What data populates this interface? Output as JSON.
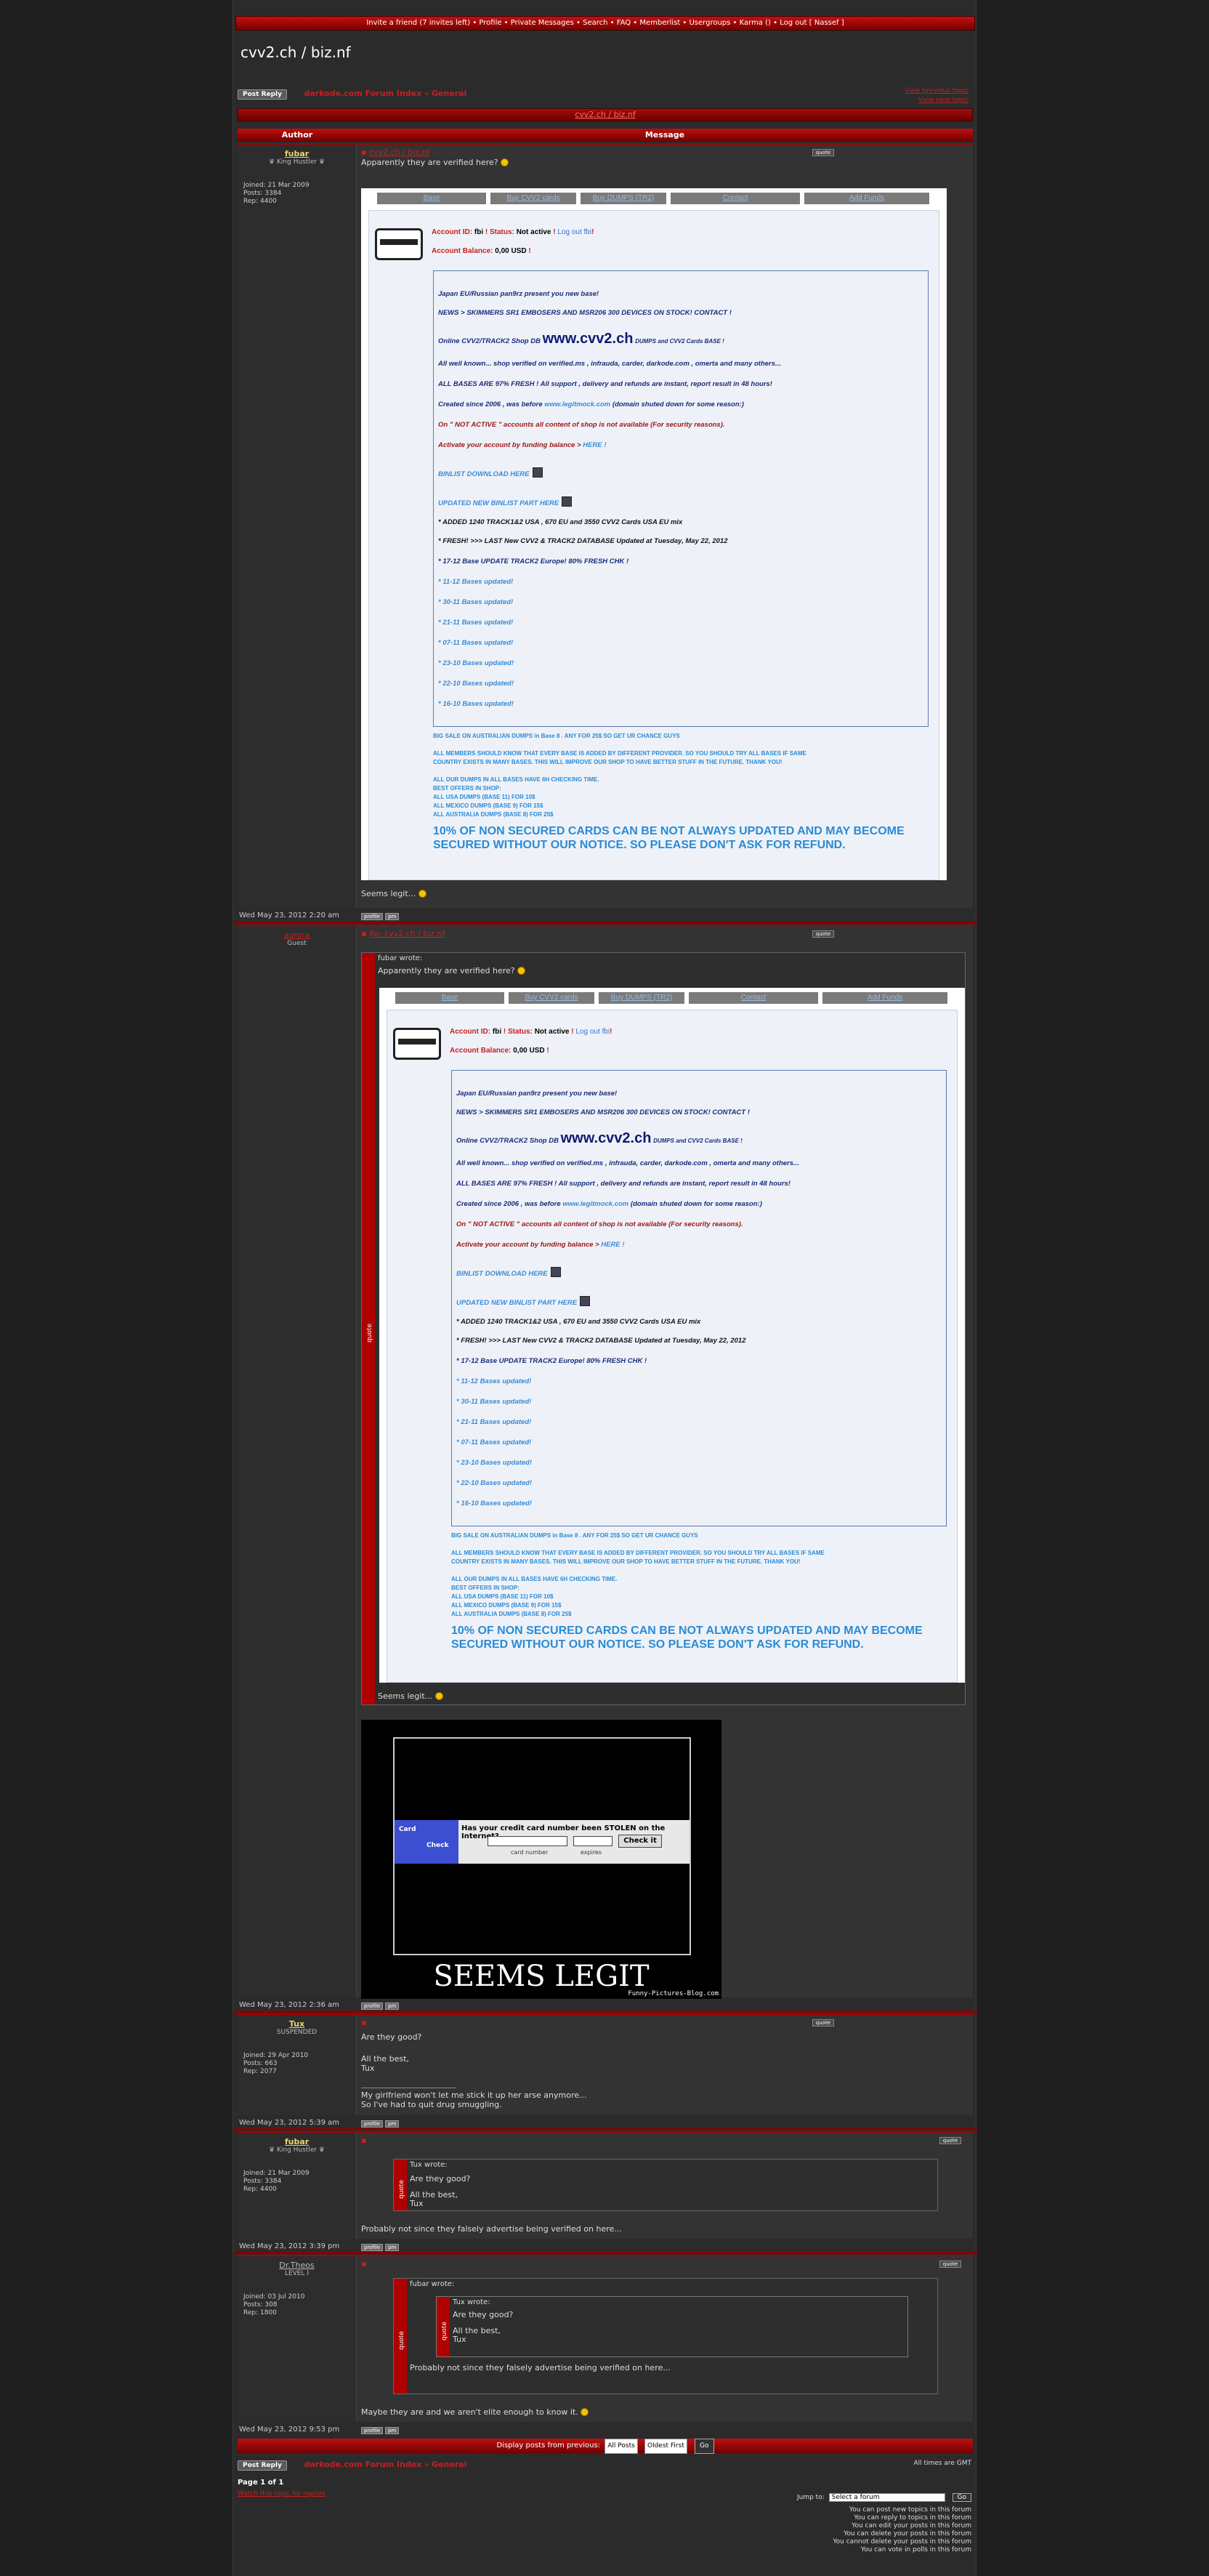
{
  "nav": {
    "links": [
      "Invite a friend (7 invites left)",
      "Profile",
      "Private Messages",
      "Search",
      "FAQ",
      "Memberlist",
      "Usergroups",
      "Karma ()",
      "Log out [ Nassef ]"
    ],
    "separator": " • "
  },
  "site_title": "cvv2.ch / biz.nf",
  "toolbar": {
    "post_reply": "Post Reply",
    "forum_index": "darkode.com Forum Index",
    "breadcrumb_sep": "»",
    "forum": "General",
    "prev_topic": "View previous topic",
    "next_topic": "View next topic"
  },
  "topic": {
    "title": "cvv2.ch / biz.nf",
    "col_author": "Author",
    "col_message": "Message"
  },
  "quote_label": "quote",
  "footer_buttons": [
    "profile",
    "pm"
  ],
  "shop": {
    "tabs": [
      "Base",
      "Buy CVV2 cards",
      "Buy DUMPS (TR2)",
      "Contact",
      "Add Funds"
    ],
    "account_id_label": "Account ID:",
    "account_id": "fbi",
    "status_label": "Status:",
    "status": "Not active",
    "logout": "Log out fbi",
    "balance_label": "Account Balance:",
    "balance": "0,00 USD",
    "lines": [
      "Japan EU/Russian pan9rz present you new base!",
      "NEWS > SKIMMERS SR1 EMBOSERS AND MSR206 300 DEVICES ON STOCK! CONTACT !",
      "Online CVV2/TRACK2 Shop DB",
      "www.cvv2.ch",
      "DUMPS and CVV2 Cards BASE !",
      "All well known... shop verified on verified.ms , infrauda, carder, darkode.com , omerta and many others...",
      "ALL BASES ARE 97% FRESH ! All support , delivery and refunds are instant, report result in 48 hours!",
      "Created since 2006 , was before",
      "www.legitmock.com",
      "(domain shuted down for some reason:)",
      "On \" NOT ACTIVE \" accounts all content of shop is not available (For security reasons).",
      "Activate your account by funding balance >",
      "HERE !",
      "BINLIST DOWNLOAD HERE",
      "UPDATED NEW BINLIST PART HERE",
      "* ADDED 1240 TRACK1&2 USA , 670 EU and 3550 CVV2 Cards USA EU mix",
      "* FRESH! >>> LAST New CVV2 & TRACK2 DATABASE Updated at Tuesday, May 22, 2012",
      "* 17-12 Base UPDATE TRACK2 Europe! 80% FRESH CHK !",
      "* 11-12 Bases updated!",
      "* 30-11 Bases updated!",
      "* 21-11 Bases updated!",
      "* 07-11 Bases updated!",
      "* 23-10 Bases updated!",
      "* 22-10 Bases updated!",
      "* 16-10 Bases updated!"
    ],
    "extra": [
      "BIG SALE ON AUSTRALIAN DUMPS in Base 8 . ANY FOR 25$ SO GET UR CHANCE GUYS",
      "ALL MEMBERS SHOULD KNOW THAT EVERY BASE IS ADDED BY DIFFERENT PROVIDER. SO YOU SHOULD TRY ALL BASES IF SAME",
      "COUNTRY EXISTS IN MANY BASES. THIS WILL IMPROVE OUR SHOP TO HAVE BETTER STUFF IN THE FUTURE. THANK YOU!",
      "ALL OUR DUMPS IN ALL BASES HAVE 6H CHECKING TIME.",
      "BEST OFFERS IN SHOP:",
      "ALL USA DUMPS (BASE 11) FOR 10$",
      "ALL MEXICO DUMPS (BASE 9) FOR 15$",
      "ALL AUSTRALIA DUMPS (BASE 8) FOR 25$"
    ],
    "warning": "10% OF NON SECURED CARDS CAN BE NOT ALWAYS UPDATED AND MAY BECOME SECURED WITHOUT OUR NOTICE. SO PLEASE DON'T ASK FOR REFUND."
  },
  "posts": [
    {
      "author": "fubar",
      "rank": "♛ King Hustler ♛",
      "joined": "Joined: 21 Mar 2009",
      "posts": "Posts: 3384",
      "rep": "Rep: 4400",
      "subject": "cvv2.ch / biz.nf",
      "text": "Apparently they are verified here?",
      "after": "Seems legit...",
      "date": "Wed May 23, 2012 2:20 am"
    },
    {
      "author": "aurora",
      "rank": "Guest",
      "subject": "Re: cvv2.ch / biz.nf",
      "quote_header": "fubar wrote:",
      "quote_text": "Apparently they are verified here?",
      "quote_after": "Seems legit...",
      "date": "Wed May 23, 2012 2:36 am"
    },
    {
      "author": "Tux",
      "rank": "SUSPENDED",
      "joined": "Joined: 29 Apr 2010",
      "posts": "Posts: 663",
      "rep": "Rep: 2077",
      "text1": "Are they good?",
      "text2": "All the best,",
      "text3": "Tux",
      "sig1": "My girlfriend won't let me stick it up her arse anymore...",
      "sig2": "So I've had to quit drug smuggling.",
      "date": "Wed May 23, 2012 5:39 am"
    },
    {
      "author": "fubar",
      "rank": "♛ King Hustler ♛",
      "joined": "Joined: 21 Mar 2009",
      "posts": "Posts: 3384",
      "rep": "Rep: 4400",
      "quote_header": "Tux wrote:",
      "q1": "Are they good?",
      "q2": "All the best,",
      "q3": "Tux",
      "text": "Probably not since they falsely advertise being verified on here...",
      "date": "Wed May 23, 2012 3:39 pm"
    },
    {
      "author": "Dr.Theos",
      "rank": "LEVEL I",
      "joined": "Joined: 03 Jul 2010",
      "posts": "Posts: 308",
      "rep": "Rep: 1800",
      "quote_header": "fubar wrote:",
      "inner_header": "Tux wrote:",
      "q1": "Are they good?",
      "q2": "All the best,",
      "q3": "Tux",
      "quote_text": "Probably not since they falsely advertise being verified on here...",
      "text": "Maybe they are and we aren't elite enough to know it.",
      "date": "Wed May 23, 2012 9:53 pm"
    }
  ],
  "legit_image": {
    "headline": "Has your credit card number been STOLEN on the Internet?",
    "field1": "card number",
    "field2": "expires",
    "button": "Check it",
    "logo1": "Card",
    "logo2": "Check",
    "caption": "SEEMS LEGIT",
    "watermark": "Funny-Pictures-Blog.com"
  },
  "bottom": {
    "display_label": "Display posts from previous:",
    "all_posts": "All Posts",
    "oldest_first": "Oldest First",
    "go": "Go",
    "times": "All times are GMT",
    "page": "Page 1 of 1",
    "watch": "Watch this topic for replies",
    "jump_label": "Jump to:",
    "jump_select": "Select a forum",
    "jump_go": "Go",
    "perms": [
      "You can post new topics in this forum",
      "You can reply to topics in this forum",
      "You can edit your posts in this forum",
      "You can delete your posts in this forum",
      "You cannot delete your posts in this forum",
      "You can vote in polls in this forum"
    ]
  }
}
